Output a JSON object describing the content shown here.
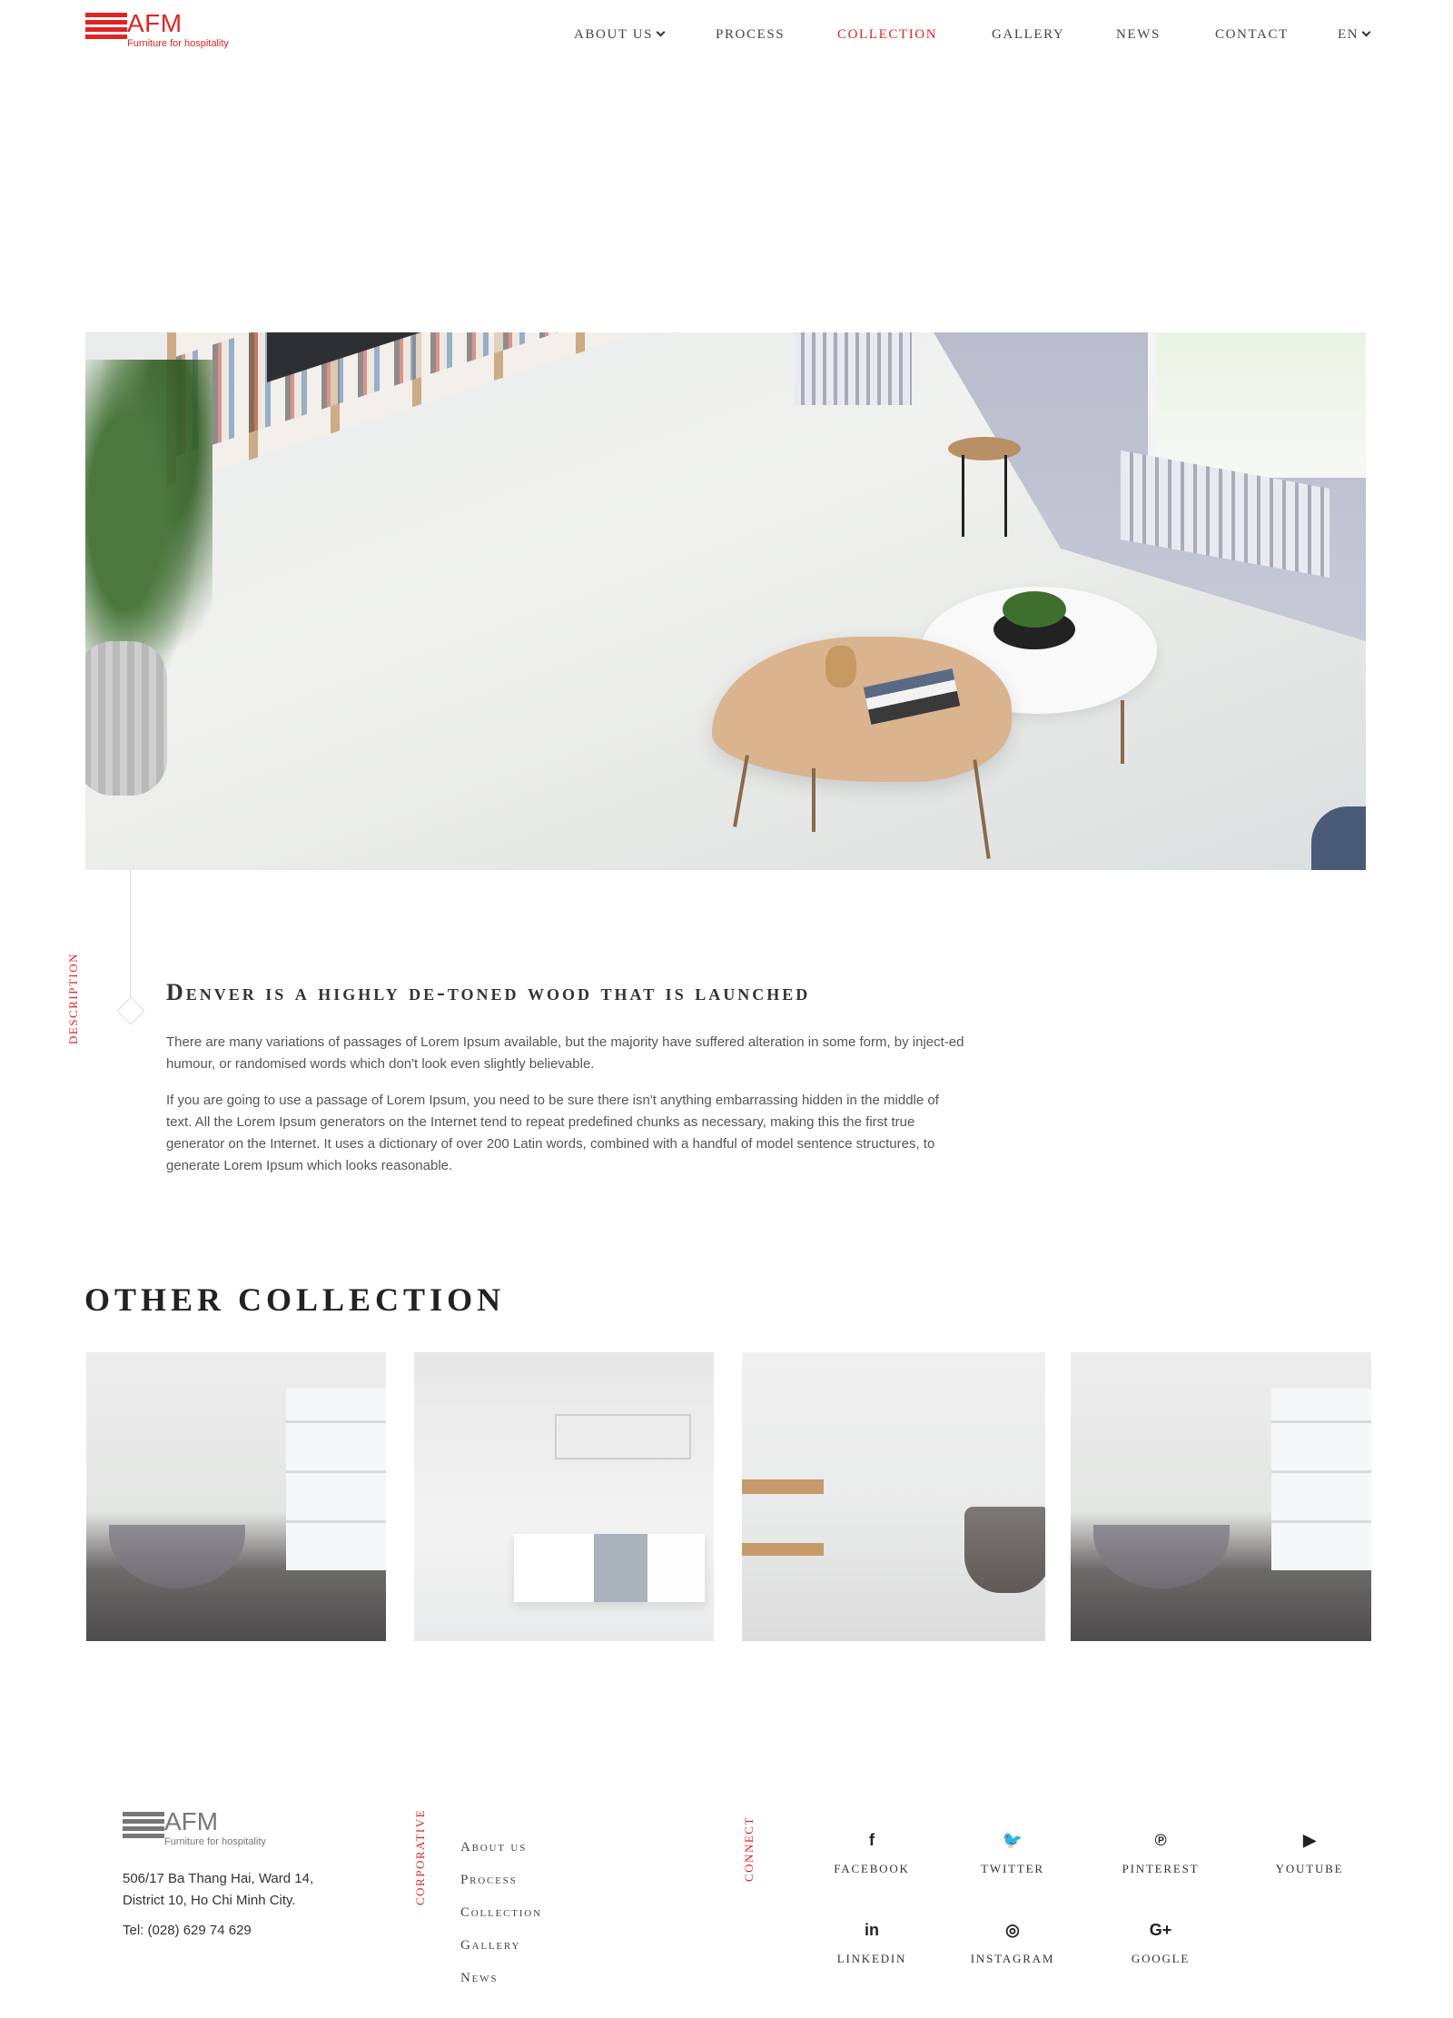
{
  "brand": {
    "name": "AFM",
    "tagline": "Furniture for hospitality",
    "accent_color": "#e02424",
    "logo_bar_color": "#e02424",
    "footer_logo_color": "#777777"
  },
  "nav": {
    "items": [
      {
        "label": "ABOUT US",
        "has_dropdown": true,
        "active": false
      },
      {
        "label": "PROCESS",
        "has_dropdown": false,
        "active": false
      },
      {
        "label": "COLLECTION",
        "has_dropdown": false,
        "active": true
      },
      {
        "label": "GALLERY",
        "has_dropdown": false,
        "active": false
      },
      {
        "label": "NEWS",
        "has_dropdown": false,
        "active": false
      },
      {
        "label": "CONTACT",
        "has_dropdown": false,
        "active": false
      }
    ],
    "language": "EN"
  },
  "description": {
    "side_label": "DESCRIPTION",
    "title": "Denver is a highly de-toned wood that is launched",
    "paragraphs": [
      "There are many variations of passages of Lorem Ipsum available, but the majority have suffered alteration in some form, by inject-ed humour, or randomised words which don't look even slightly believable.",
      "If you are going to use a passage of Lorem Ipsum, you need to be sure there isn't anything embarrassing hidden in the middle of text. All the Lorem Ipsum generators on the Internet tend to repeat predefined chunks as necessary, making this the first true generator on the Internet. It uses a dictionary of over 200 Latin words, combined with a handful of model sentence structures, to generate Lorem Ipsum which looks reasonable."
    ]
  },
  "other_collection": {
    "title": "OTHER COLLECTION"
  },
  "footer": {
    "address_line1": "506/17 Ba Thang Hai, Ward 14,",
    "address_line2": "District 10, Ho Chi Minh City.",
    "phone": "Tel: (028) 629 74 629",
    "corporative_label": "CORPORATIVE",
    "links": [
      "About us",
      "Process",
      "Collection",
      "Gallery",
      "News"
    ],
    "connect_label": "CONNECT",
    "social": [
      {
        "icon": "facebook-icon",
        "glyph": "f",
        "label": "FACEBOOK"
      },
      {
        "icon": "twitter-icon",
        "glyph": "🐦",
        "label": "TWITTER"
      },
      {
        "icon": "pinterest-icon",
        "glyph": "℗",
        "label": "PINTEREST"
      },
      {
        "icon": "youtube-icon",
        "glyph": "▶",
        "label": "YOUTUBE"
      },
      {
        "icon": "linkedin-icon",
        "glyph": "in",
        "label": "LINKEDIN"
      },
      {
        "icon": "instagram-icon",
        "glyph": "◎",
        "label": "INSTAGRAM"
      },
      {
        "icon": "google-plus-icon",
        "glyph": "G+",
        "label": "GOOGLE"
      }
    ]
  }
}
